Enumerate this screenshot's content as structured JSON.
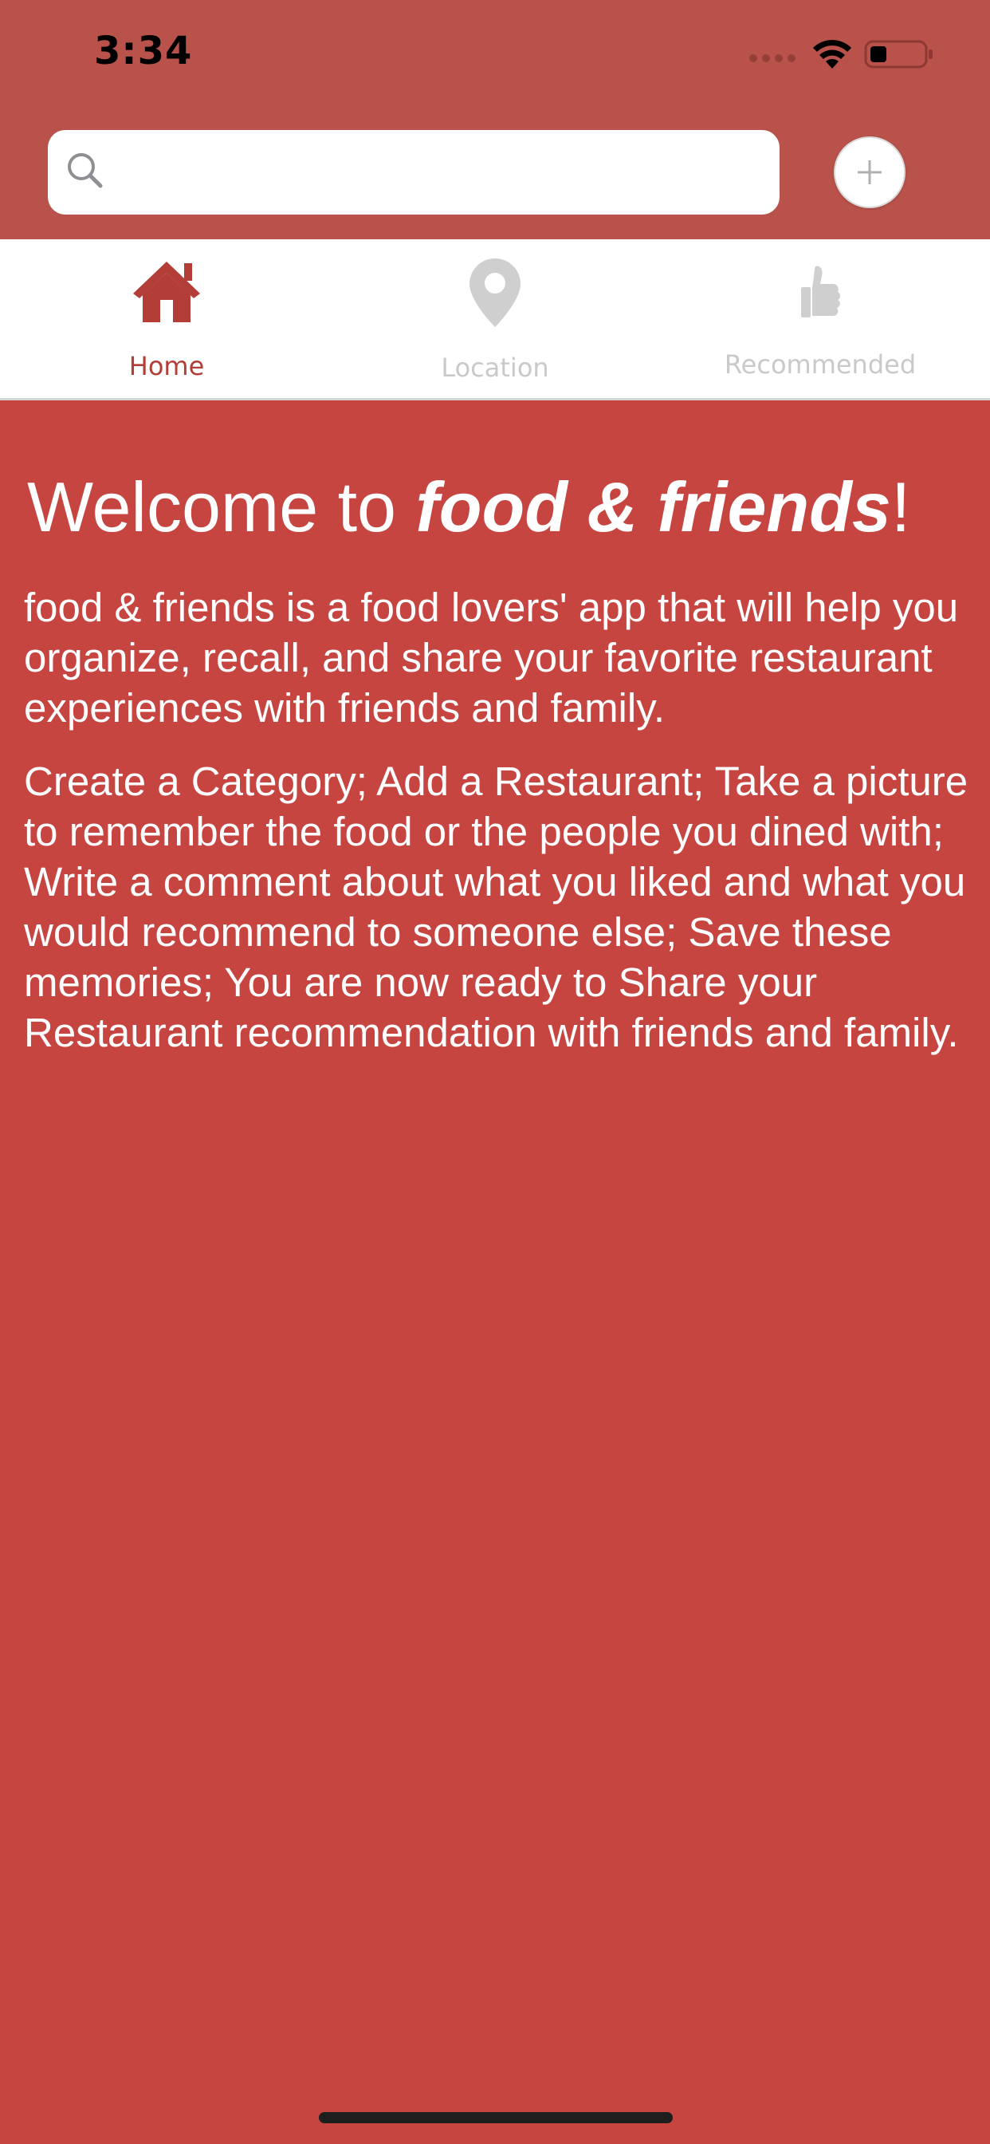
{
  "status_bar": {
    "time": "3:34"
  },
  "search": {
    "value": "",
    "placeholder": ""
  },
  "tabs": [
    {
      "label": "Home",
      "icon": "home-icon",
      "active": true
    },
    {
      "label": "Location",
      "icon": "location-pin-icon",
      "active": false
    },
    {
      "label": "Recommended",
      "icon": "thumbs-up-icon",
      "active": false
    }
  ],
  "welcome": {
    "prefix": "Welcome to ",
    "brand": "food & friends",
    "suffix": "!"
  },
  "paragraphs": [
    "food & friends is a food lovers' app that will help you organize, recall, and share your favorite restaurant experiences with friends and family.",
    "Create a Category; Add a Restaurant; Take a picture to remember the food or the people you dined with; Write a comment about what you liked and what you would recommend to someone else; Save these memories; You are now ready to Share your Restaurant recommendation with friends and family."
  ],
  "colors": {
    "header_background": "#b8524a",
    "content_background": "#c64541",
    "active_tab": "#b33d37",
    "inactive_tab": "#c9c9c9"
  }
}
